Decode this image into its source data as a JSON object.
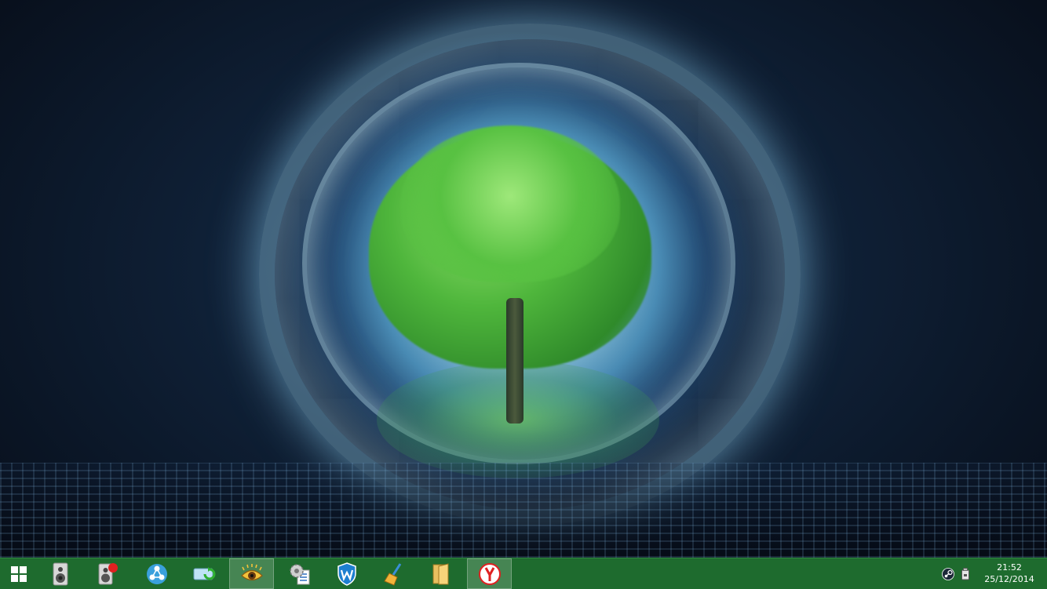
{
  "desktop": {
    "wallpaper": "glowing-tree-portal"
  },
  "taskbar": {
    "color": "#1e6b2e",
    "start": {
      "icon": "windows-logo-icon"
    },
    "pinned": [
      {
        "name": "speakers-app",
        "icon": "speaker-icon",
        "active": false
      },
      {
        "name": "speakers-app-alert",
        "icon": "speaker-red-badge-icon",
        "active": false
      },
      {
        "name": "network-app",
        "icon": "triangle-nodes-icon",
        "active": false
      },
      {
        "name": "battery-app",
        "icon": "battery-recycle-icon",
        "active": false
      },
      {
        "name": "eye-app",
        "icon": "eye-icon",
        "active": true
      },
      {
        "name": "settings-app",
        "icon": "gear-document-icon",
        "active": false
      },
      {
        "name": "shield-app",
        "icon": "shield-w-icon",
        "active": false
      },
      {
        "name": "cleaner-app",
        "icon": "broom-icon",
        "active": false
      },
      {
        "name": "file-explorer",
        "icon": "folder-icon",
        "active": false
      },
      {
        "name": "yandex-browser",
        "icon": "yandex-y-icon",
        "active": true
      }
    ],
    "tray": {
      "icons": [
        "steam-icon",
        "usb-drive-icon"
      ],
      "time": "21:52",
      "date": "25/12/2014"
    }
  }
}
